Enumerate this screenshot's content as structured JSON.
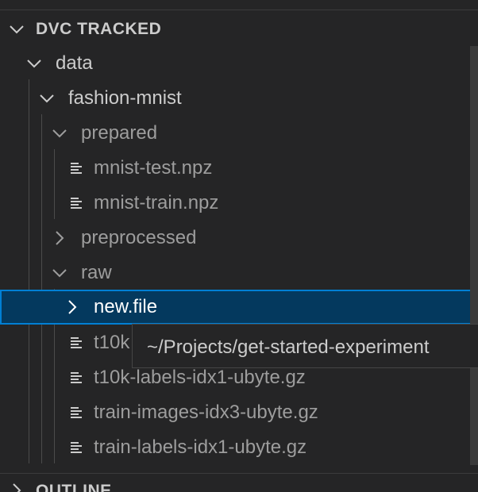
{
  "section": {
    "title": "DVC TRACKED"
  },
  "tree": {
    "data": "data",
    "fashion_mnist": "fashion-mnist",
    "prepared": "prepared",
    "mnist_test": "mnist-test.npz",
    "mnist_train": "mnist-train.npz",
    "preprocessed": "preprocessed",
    "raw": "raw",
    "new_file": "new.file",
    "t10k_images_partial": "t10k",
    "t10k_labels": "t10k-labels-idx1-ubyte.gz",
    "train_images": "train-images-idx3-ubyte.gz",
    "train_labels": "train-labels-idx1-ubyte.gz"
  },
  "tooltip": {
    "text": "~/Projects/get-started-experiment"
  },
  "outline": {
    "title": "OUTLINE"
  },
  "colors": {
    "background": "#252526",
    "selected_background": "#04395e",
    "focus_border": "#007fd4",
    "text_bright": "#cccccc",
    "text_dim": "#9d9d9d"
  },
  "icons": {
    "expanded": "chevron-down-icon",
    "collapsed": "chevron-right-icon",
    "file": "file-lines-icon"
  }
}
